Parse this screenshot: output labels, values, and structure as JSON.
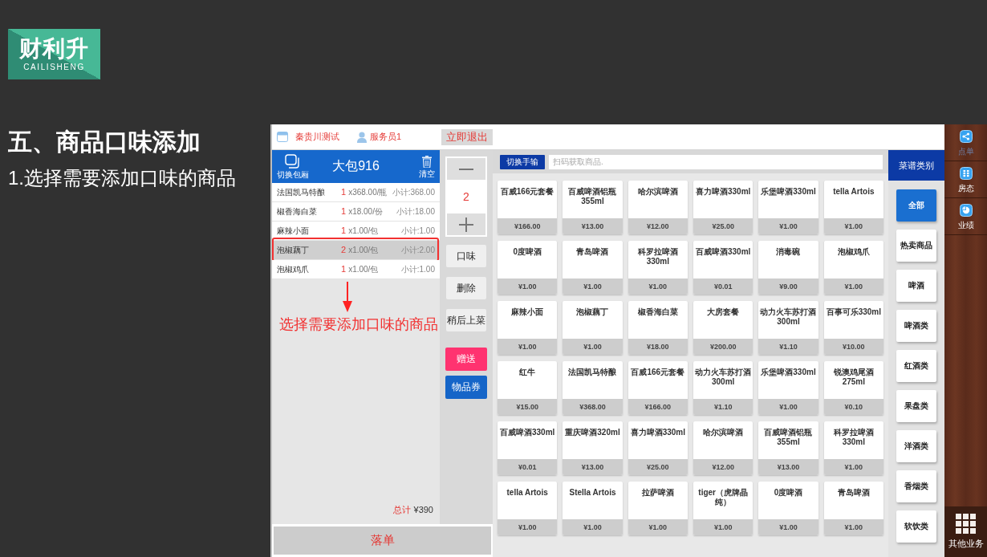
{
  "logo": {
    "wordmark": "财利升",
    "tagline": "CAILISHENG"
  },
  "slide": {
    "title": "五、商品口味添加",
    "subtitle": "1.选择需要添加口味的商品"
  },
  "top_bar": {
    "store": "秦贵川测试",
    "waiter": "服务员1",
    "logout": "立即退出"
  },
  "order": {
    "switch_label": "切换包厢",
    "room": "大包916",
    "clear_label": "清空",
    "items": [
      {
        "name": "法国凯马特酿",
        "qty": "1",
        "price": "x368.00/瓶",
        "subtotal": "小计:368.00",
        "selected": false
      },
      {
        "name": "椒香海白菜",
        "qty": "1",
        "price": "x18.00/份",
        "subtotal": "小计:18.00",
        "selected": false
      },
      {
        "name": "麻辣小面",
        "qty": "1",
        "price": "x1.00/包",
        "subtotal": "小计:1.00",
        "selected": false
      },
      {
        "name": "泡椒藕丁",
        "qty": "2",
        "price": "x1.00/包",
        "subtotal": "小计:2.00",
        "selected": true
      },
      {
        "name": "泡椒鸡爪",
        "qty": "1",
        "price": "x1.00/包",
        "subtotal": "小计:1.00",
        "selected": false
      }
    ],
    "total_label": "总计",
    "total": "¥390",
    "submit": "落单"
  },
  "annotation": {
    "text": "选择需要添加口味的商品"
  },
  "actions": {
    "quantity": "2",
    "buttons": [
      {
        "label": "口味",
        "kind": "plain"
      },
      {
        "label": "删除",
        "kind": "plain"
      },
      {
        "label": "稍后上菜",
        "kind": "plain"
      },
      {
        "label": "赠送",
        "kind": "gift"
      },
      {
        "label": "物品券",
        "kind": "voucher"
      }
    ]
  },
  "products": {
    "mode_button": "切换手输",
    "search_placeholder": "扫码获取商品.",
    "items": [
      {
        "name": "百威166元套餐",
        "price": "¥166.00"
      },
      {
        "name": "百威啤酒铝瓶355ml",
        "price": "¥13.00"
      },
      {
        "name": "哈尔滨啤酒",
        "price": "¥12.00"
      },
      {
        "name": "喜力啤酒330ml",
        "price": "¥25.00"
      },
      {
        "name": "乐堡啤酒330ml",
        "price": "¥1.00"
      },
      {
        "name": "tella Artois",
        "price": "¥1.00"
      },
      {
        "name": "0度啤酒",
        "price": "¥1.00"
      },
      {
        "name": "青岛啤酒",
        "price": "¥1.00"
      },
      {
        "name": "科罗拉啤酒330ml",
        "price": "¥1.00"
      },
      {
        "name": "百威啤酒330ml",
        "price": "¥0.01"
      },
      {
        "name": "消毒碗",
        "price": "¥9.00"
      },
      {
        "name": "泡椒鸡爪",
        "price": "¥1.00"
      },
      {
        "name": "麻辣小面",
        "price": "¥1.00"
      },
      {
        "name": "泡椒藕丁",
        "price": "¥1.00"
      },
      {
        "name": "椒香海白菜",
        "price": "¥18.00"
      },
      {
        "name": "大房套餐",
        "price": "¥200.00"
      },
      {
        "name": "动力火车苏打酒300ml",
        "price": "¥1.10"
      },
      {
        "name": "百事可乐330ml",
        "price": "¥10.00"
      },
      {
        "name": "红牛",
        "price": "¥15.00"
      },
      {
        "name": "法国凯马特酿",
        "price": "¥368.00"
      },
      {
        "name": "百威166元套餐",
        "price": "¥166.00"
      },
      {
        "name": "动力火车苏打酒300ml",
        "price": "¥1.10"
      },
      {
        "name": "乐堡啤酒330ml",
        "price": "¥1.00"
      },
      {
        "name": "锐澳鸡尾酒275ml",
        "price": "¥0.10"
      },
      {
        "name": "百威啤酒330ml",
        "price": "¥0.01"
      },
      {
        "name": "重庆啤酒320ml",
        "price": "¥13.00"
      },
      {
        "name": "喜力啤酒330ml",
        "price": "¥25.00"
      },
      {
        "name": "哈尔滨啤酒",
        "price": "¥12.00"
      },
      {
        "name": "百威啤酒铝瓶355ml",
        "price": "¥13.00"
      },
      {
        "name": "科罗拉啤酒330ml",
        "price": "¥1.00"
      },
      {
        "name": "tella Artois",
        "price": "¥1.00"
      },
      {
        "name": "Stella Artois",
        "price": "¥1.00"
      },
      {
        "name": "拉萨啤酒",
        "price": "¥1.00"
      },
      {
        "name": "tiger（虎牌晶纯）",
        "price": "¥1.00"
      },
      {
        "name": "0度啤酒",
        "price": "¥1.00"
      },
      {
        "name": "青岛啤酒",
        "price": "¥1.00"
      }
    ]
  },
  "categories": {
    "title": "菜谱类别",
    "items": [
      {
        "label": "全部",
        "selected": true
      },
      {
        "label": "热卖商品",
        "selected": false
      },
      {
        "label": "啤酒",
        "selected": false
      },
      {
        "label": "啤酒类",
        "selected": false
      },
      {
        "label": "红酒类",
        "selected": false
      },
      {
        "label": "果盘类",
        "selected": false
      },
      {
        "label": "洋酒类",
        "selected": false
      },
      {
        "label": "香烟类",
        "selected": false
      },
      {
        "label": "软饮类",
        "selected": false
      }
    ]
  },
  "nav": {
    "items": [
      {
        "label": "点单",
        "kind": "order",
        "selected": true
      },
      {
        "label": "房态",
        "kind": "rooms",
        "selected": false
      },
      {
        "label": "业绩",
        "kind": "performance",
        "selected": false
      }
    ],
    "more": "其他业务"
  }
}
